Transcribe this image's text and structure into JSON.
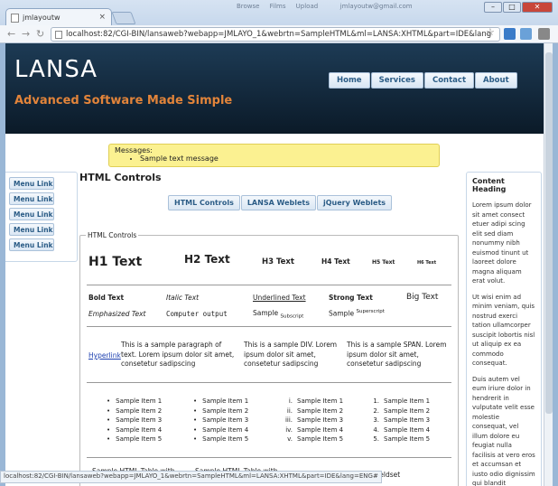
{
  "browser": {
    "tab_title": "jmlayoutw",
    "tab_close": "×",
    "window_min": "–",
    "window_max": "□",
    "window_close": "✕",
    "top_faint": [
      "Browse",
      "Films",
      "Upload",
      "jmlayoutw@gmail.com"
    ],
    "back": "←",
    "forward": "→",
    "reload": "↻",
    "url": "localhost:82/CGI-BIN/lansaweb?webapp=JMLAYO_1&webrtn=SampleHTML&ml=LANSA:XHTML&part=IDE&lang",
    "star": "☆",
    "status_url": "localhost:82/CGI-BIN/lansaweb?webapp=JMLAYO_1&webrtn=SampleHTML&ml=LANSA:XHTML&part=IDE&lang=ENG#"
  },
  "header": {
    "brand": "LANSA",
    "tagline": "Advanced Software Made Simple"
  },
  "topnav": [
    "Home",
    "Services",
    "Contact",
    "About"
  ],
  "messages": {
    "title": "Messages:",
    "items": [
      "Sample text message"
    ]
  },
  "leftmenu": [
    "Menu Link",
    "Menu Link",
    "Menu Link",
    "Menu Link",
    "Menu Link"
  ],
  "content": {
    "title": "HTML Controls",
    "subtabs": [
      "HTML Controls",
      "LANSA Weblets",
      "jQuery Weblets"
    ],
    "legend": "HTML Controls",
    "headings": [
      "H1 Text",
      "H2 Text",
      "H3 Text",
      "H4 Text",
      "H5 Text",
      "H6 Text"
    ],
    "row1": [
      "Bold Text",
      "Italic Text",
      "Underlined Text",
      "Strong Text",
      "Big Text"
    ],
    "row2": {
      "em": "Emphasized Text",
      "code": "Computer output",
      "sample": "Sample",
      "sub": "Subscript",
      "sample2": "Sample",
      "sup": "Superscript"
    },
    "hyperlink": "Hyperlink",
    "para": "This is a sample paragraph of text. Lorem ipsum dolor sit amet, consetetur sadipscing",
    "div": "This is a sample DIV. Lorem ipsum dolor sit amet, consetetur sadipscing",
    "span": "This is a sample SPAN. Lorem ipsum dolor sit amet, consetetur sadipscing",
    "list_items": [
      "Sample Item 1",
      "Sample Item 2",
      "Sample Item 3",
      "Sample Item 4",
      "Sample Item 5"
    ],
    "roman": [
      "i.",
      "ii.",
      "iii.",
      "iv.",
      "v."
    ],
    "numbers": [
      "1.",
      "2.",
      "3.",
      "4.",
      "5."
    ],
    "bottom": [
      "Sample HTML Table with",
      "Sample HTML Table with",
      "nd and Fieldset"
    ]
  },
  "sidebar": {
    "heading": "Content Heading",
    "p1": "Lorem ipsum dolor sit amet consect etuer adipi scing elit sed diam nonummy nibh euismod tinunt ut laoreet dolore magna aliquam erat volut.",
    "p2": "Ut wisi enim ad minim veniam, quis nostrud exerci tation ullamcorper suscipit lobortis nisl ut aliquip ex ea commodo consequat.",
    "p3": "Duis autem vel eum iriure dolor in hendrerit in vulputate velit esse molestie consequat, vel illum dolore eu feugiat nulla facilisis at vero eros et accumsan et iusto odio dignissim qui blandit praesent luptatum zzril delenit"
  },
  "colors": {
    "accent": "#e2843a",
    "header_bg": "#0b1a28",
    "link": "#2b5c86",
    "message_bg": "#fbf191"
  }
}
